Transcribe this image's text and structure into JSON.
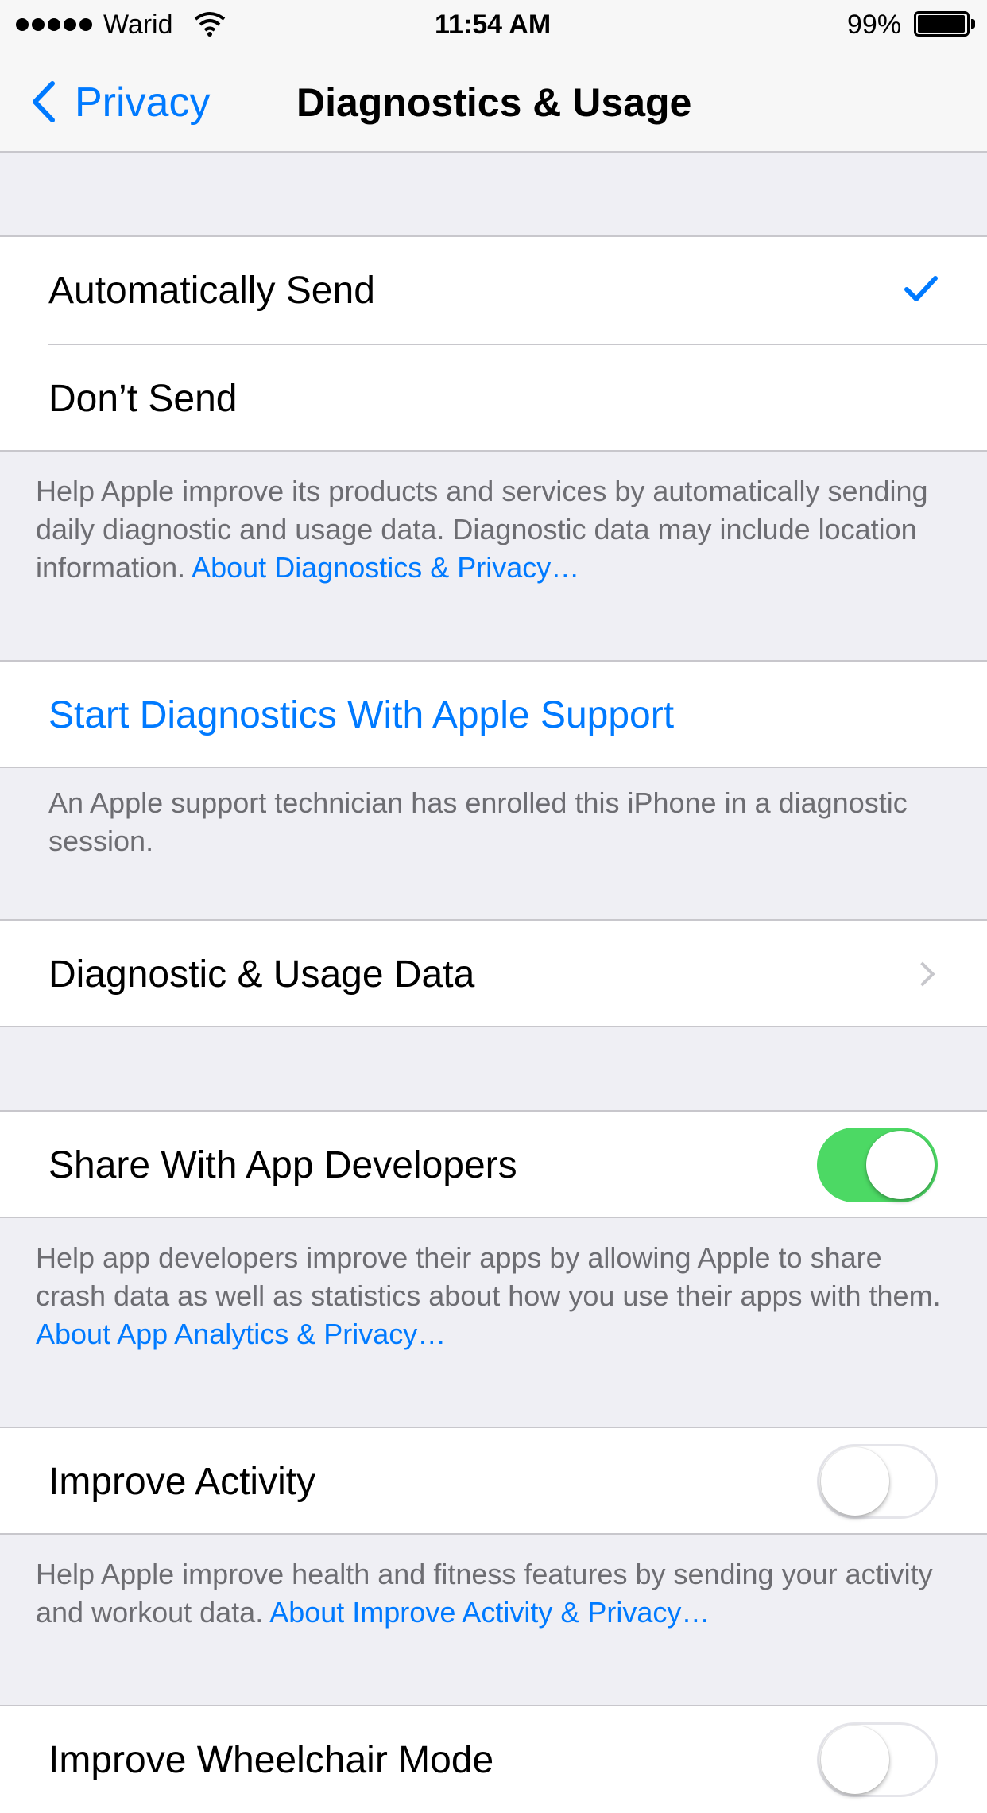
{
  "status_bar": {
    "carrier": "Warid",
    "time": "11:54 AM",
    "battery_percent": "99%",
    "battery_level": 0.99
  },
  "nav": {
    "back_label": "Privacy",
    "title": "Diagnostics & Usage"
  },
  "send_options": {
    "items": [
      {
        "label": "Automatically Send",
        "selected": true
      },
      {
        "label": "Don’t Send",
        "selected": false
      }
    ],
    "footer_text": "Help Apple improve its products and services by automatically sending daily diagnostic and usage data. Diagnostic data may include location information.",
    "footer_link": "About Diagnostics & Privacy…"
  },
  "apple_support": {
    "label": "Start Diagnostics With Apple Support",
    "footer_text": "An Apple support technician has enrolled this iPhone in a diagnostic session."
  },
  "usage_data": {
    "label": "Diagnostic & Usage Data"
  },
  "share_developers": {
    "label": "Share With App Developers",
    "enabled": true,
    "footer_text": "Help app developers improve their apps by allowing Apple to share crash data as well as statistics about how you use their apps with them.",
    "footer_link": "About App Analytics & Privacy…"
  },
  "improve_activity": {
    "label": "Improve Activity",
    "enabled": false,
    "footer_text": "Help Apple improve health and fitness features by sending your activity and workout data.",
    "footer_link": "About Improve Activity & Privacy…"
  },
  "wheelchair": {
    "label": "Improve Wheelchair Mode",
    "enabled": false
  },
  "colors": {
    "accent": "#007aff",
    "switch_on": "#4cd964",
    "background": "#efeff4"
  }
}
